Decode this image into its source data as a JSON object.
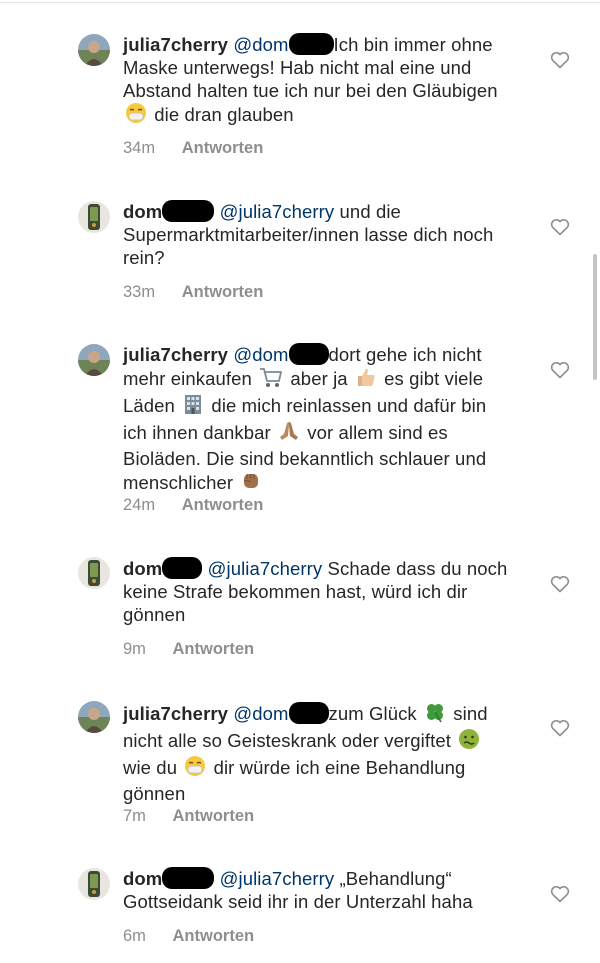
{
  "comments": [
    {
      "username": "julia7cherry",
      "mention": "@dom",
      "text_segments": [
        "Ich bin immer ohne Maske unterwegs! Hab nicht mal eine und Abstand halten tue ich nur bei den Gläubigen ",
        " die dran glauben"
      ],
      "time": "34m",
      "reply_label": "Antworten",
      "avatar": "woman-outdoor-avatar"
    },
    {
      "username": "dom",
      "mention": "@julia7cherry",
      "text_segments": [
        " und die Supermarktmitarbeiter/innen lasse dich noch rein?"
      ],
      "time": "33m",
      "reply_label": "Antworten",
      "avatar": "phone-case-avatar"
    },
    {
      "username": "julia7cherry",
      "mention": "@dom",
      "text_segments": [
        "dort gehe ich nicht mehr einkaufen ",
        " aber ja ",
        " es gibt viele Läden ",
        " die mich reinlassen und dafür bin ich ihnen dankbar ",
        " vor allem sind es Bioläden. Die sind bekanntlich schlauer und menschlicher "
      ],
      "time": "24m",
      "reply_label": "Antworten",
      "avatar": "woman-outdoor-avatar"
    },
    {
      "username": "dom",
      "mention": "@julia7cherry",
      "text_segments": [
        " Schade dass du noch keine Strafe bekommen hast, würd ich dir gönnen"
      ],
      "time": "9m",
      "reply_label": "Antworten",
      "avatar": "phone-case-avatar"
    },
    {
      "username": "julia7cherry",
      "mention": "@dom",
      "text_segments": [
        "zum Glück ",
        " sind nicht alle so Geisteskrank oder vergiftet ",
        " wie du ",
        " dir würde ich eine Behandlung gönnen"
      ],
      "time": "7m",
      "reply_label": "Antworten",
      "avatar": "woman-outdoor-avatar"
    },
    {
      "username": "dom",
      "mention": "@julia7cherry",
      "text_segments": [
        " „Behandlung“ Gottseidank seid ihr in der Unterzahl haha"
      ],
      "time": "6m",
      "reply_label": "Antworten",
      "avatar": "phone-case-avatar"
    }
  ],
  "icons": {
    "like": "heart-outline-icon",
    "mask": "face-with-medical-mask-icon",
    "cart": "shopping-cart-icon",
    "thumbs_up": "thumbs-up-icon",
    "building": "office-building-icon",
    "pray": "folded-hands-icon",
    "fist": "raised-fist-icon",
    "clover": "four-leaf-clover-icon",
    "nauseated": "nauseated-face-icon"
  },
  "colors": {
    "text": "#262626",
    "mention": "#003569",
    "meta": "#8e8e8e",
    "redaction": "#000000"
  }
}
